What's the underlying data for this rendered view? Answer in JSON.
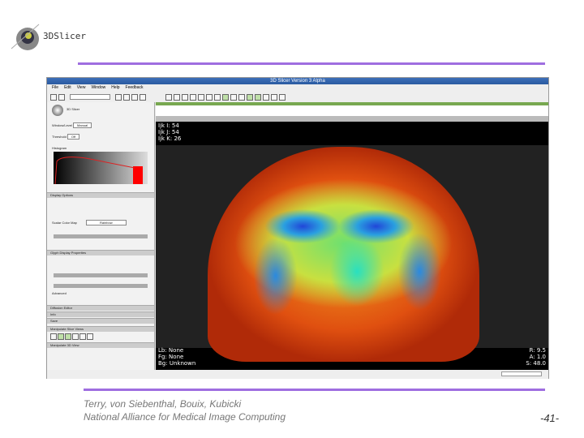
{
  "slide": {
    "logo_text": "3DSlicer",
    "credits": [
      "Terry, von Siebenthal, Bouix, Kubicki",
      "National Alliance for Medical Image Computing"
    ],
    "page_number": "-41-",
    "accent": "#9f6ee0"
  },
  "window": {
    "title": "3D Slicer Version 3 Alpha",
    "menu": [
      "File",
      "Edit",
      "View",
      "Window",
      "Help",
      "Feedback"
    ]
  },
  "left_panel": {
    "module_title": "3D Slicer",
    "window_level_label": "Window/Level",
    "window_level_mode": "Manual",
    "threshold_label": "Threshold",
    "threshold_mode": "Off",
    "histogram_label": "Histogram",
    "glyph_section": "Display Options",
    "scalar_color_label": "Scalar Color Map",
    "scalar_color_value": "Rainbow",
    "glyph_props": "Glyph Display Properties",
    "advanced": "Advanced",
    "sections": [
      "Diffusion Editor",
      "Info",
      "Save"
    ],
    "manipulate_slice": "Manipulate Slice Views",
    "manipulate_3d": "Manipulate 3D View"
  },
  "viewer": {
    "top_left": [
      "Ijk I: 54",
      "Ijk J: 54",
      "Ijk K: 26"
    ],
    "bottom_left": [
      "Lb: None",
      "Fg: None",
      "Bg: Unknown"
    ],
    "bottom_right": [
      "R: 9.5",
      "A: 1.0",
      "S: 48.0"
    ]
  }
}
